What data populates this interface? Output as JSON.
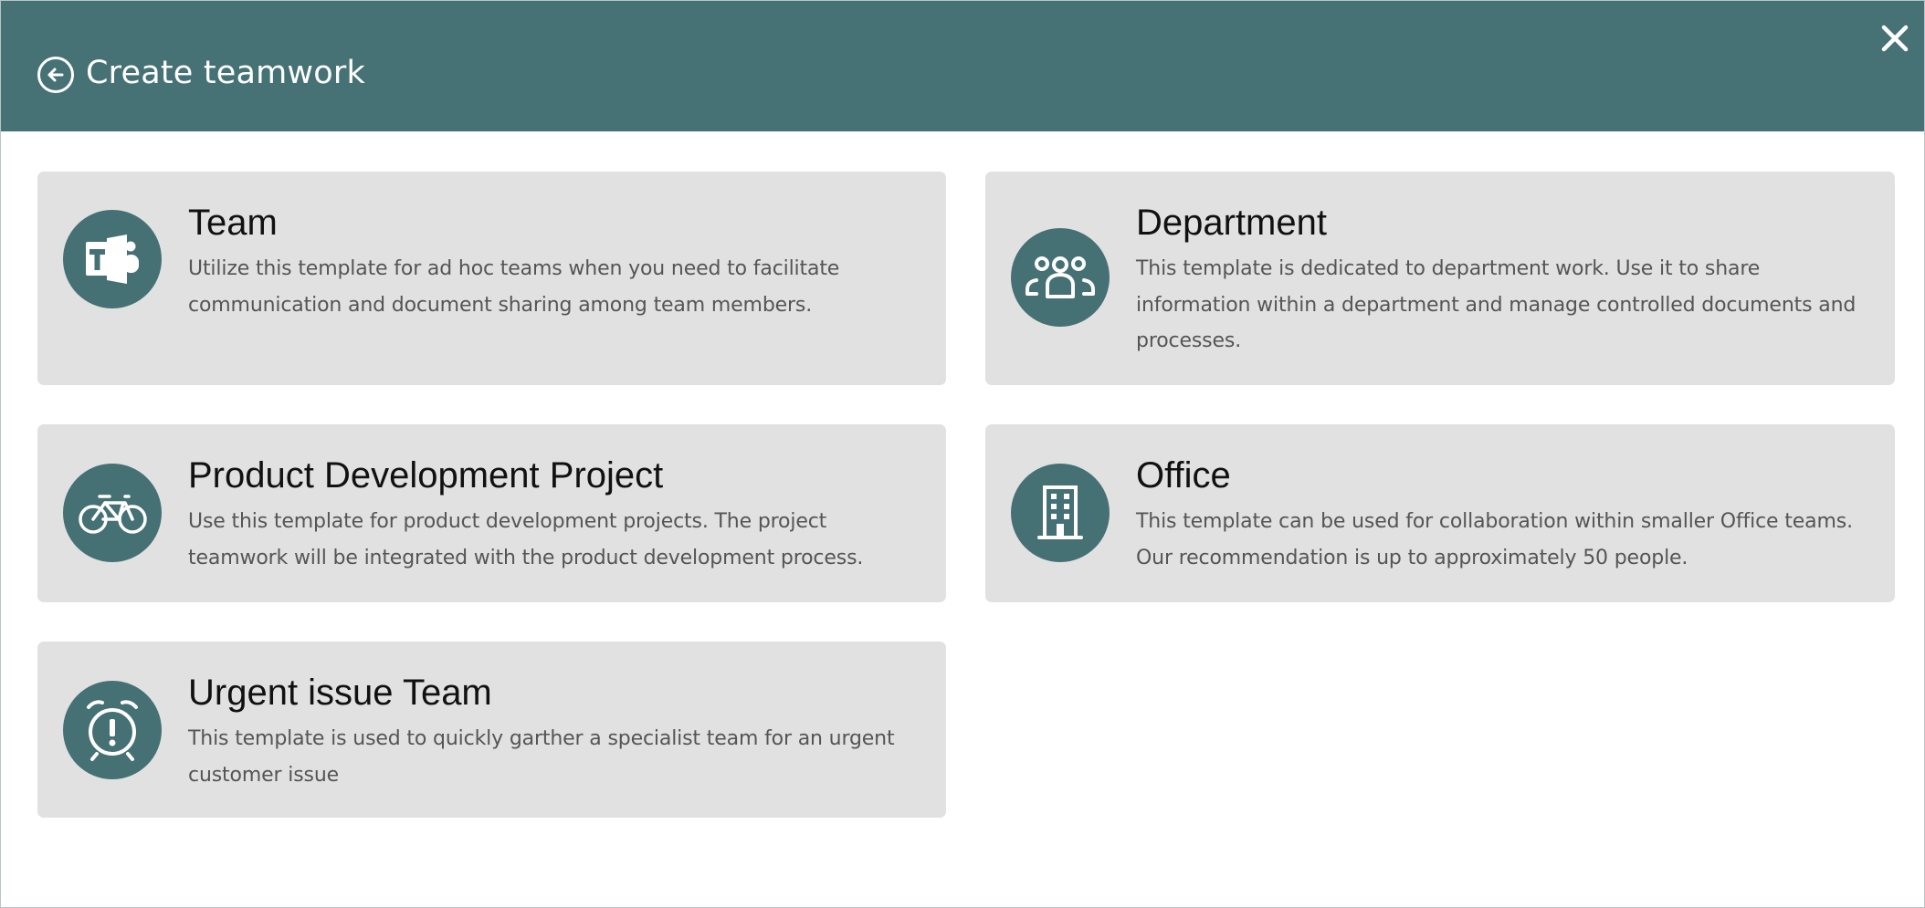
{
  "header": {
    "title": "Create teamwork",
    "background_color": "#467175",
    "back_icon": "back-arrow-circle-icon",
    "close_icon": "close-icon"
  },
  "templates": [
    {
      "title": "Team",
      "description": "Utilize this template for ad hoc teams when you need to facilitate communication and document sharing among team members.",
      "icon": "teams-icon"
    },
    {
      "title": "Department",
      "description": "This template is dedicated to department work. Use it to share information within a department and manage controlled documents and processes.",
      "icon": "people-group-icon"
    },
    {
      "title": "Product Development Project",
      "description": "Use this template for product development projects. The project teamwork will be integrated with the product development process.",
      "icon": "bicycle-icon"
    },
    {
      "title": "Office",
      "description": "This template can be used for collaboration within smaller Office teams. Our recommendation is up to approximately 50 people.",
      "icon": "office-building-icon"
    },
    {
      "title": "Urgent issue Team",
      "description": "This template is used to quickly garther a specialist team for an urgent customer issue",
      "icon": "alarm-clock-alert-icon"
    }
  ],
  "colors": {
    "accent": "#457074",
    "card_background": "#e1e1e1",
    "title_text": "#111111",
    "description_text": "#555555"
  }
}
